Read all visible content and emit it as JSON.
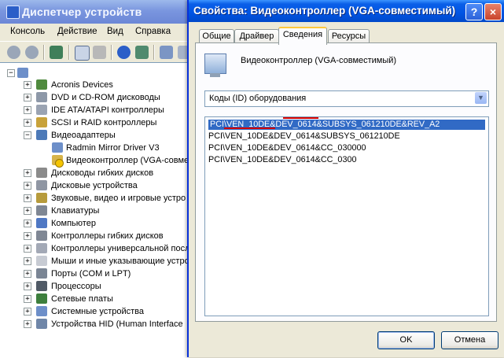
{
  "device_manager": {
    "title": "Диспетчер устройств",
    "menu": [
      "Консоль",
      "Действие",
      "Вид",
      "Справка"
    ],
    "toolbar_icons": [
      "back-icon",
      "forward-icon",
      "tree-view-icon",
      "properties-icon",
      "print-icon",
      "help-icon",
      "update-driver-icon",
      "scan-hardware-icon",
      "uninstall-icon",
      "disable-icon"
    ],
    "tree": [
      {
        "label": "Acronis Devices"
      },
      {
        "label": "DVD и CD-ROM дисководы"
      },
      {
        "label": "IDE ATA/ATAPI контроллеры"
      },
      {
        "label": "SCSI и RAID контроллеры"
      },
      {
        "label": "Видеоадаптеры"
      },
      {
        "label": "Radmin Mirror Driver V3"
      },
      {
        "label": "Видеоконтроллер (VGA-совмес"
      },
      {
        "label": "Дисководы гибких дисков"
      },
      {
        "label": "Дисковые устройства"
      },
      {
        "label": "Звуковые, видео и игровые устро"
      },
      {
        "label": "Клавиатуры"
      },
      {
        "label": "Компьютер"
      },
      {
        "label": "Контроллеры гибких дисков"
      },
      {
        "label": "Контроллеры универсальной посл"
      },
      {
        "label": "Мыши и иные указывающие устро"
      },
      {
        "label": "Порты (COM и LPT)"
      },
      {
        "label": "Процессоры"
      },
      {
        "label": "Сетевые платы"
      },
      {
        "label": "Системные устройства"
      },
      {
        "label": "Устройства HID (Human Interface"
      }
    ]
  },
  "dialog": {
    "title": "Свойства: Видеоконтроллер (VGA-совместимый)",
    "help_label": "?",
    "close_label": "×",
    "tabs": [
      "Общие",
      "Драйвер",
      "Сведения",
      "Ресурсы"
    ],
    "active_tab": "Сведения",
    "device_name": "Видеоконтроллер (VGA-совместимый)",
    "property_select": "Коды (ID) оборудования",
    "values": [
      "PCI\\VEN_10DE&DEV_0614&SUBSYS_061210DE&REV_A2",
      "PCI\\VEN_10DE&DEV_0614&SUBSYS_061210DE",
      "PCI\\VEN_10DE&DEV_0614&CC_030000",
      "PCI\\VEN_10DE&DEV_0614&CC_0300"
    ],
    "ok_label": "OK",
    "cancel_label": "Отмена"
  },
  "colors": {
    "annotation_red": "#D40000",
    "selection": "#316AC5"
  }
}
